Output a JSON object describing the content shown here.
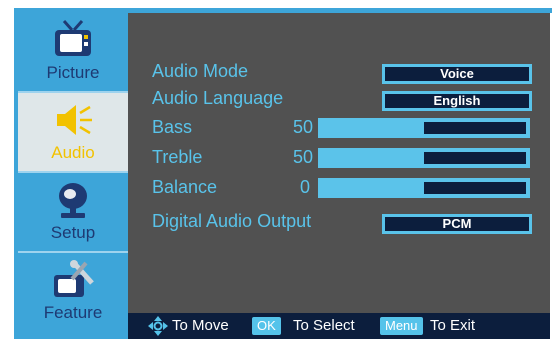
{
  "sidebar": {
    "items": [
      {
        "label": "Picture",
        "icon": "tv-icon"
      },
      {
        "label": "Audio",
        "icon": "speaker-icon",
        "active": true
      },
      {
        "label": "Setup",
        "icon": "satellite-dish-icon"
      },
      {
        "label": "Feature",
        "icon": "tv-tools-icon"
      }
    ]
  },
  "menu": {
    "audio_mode": {
      "label": "Audio Mode",
      "value": "Voice"
    },
    "audio_language": {
      "label": "Audio Language",
      "value": "English"
    },
    "bass": {
      "label": "Bass",
      "value": "50",
      "level": 0.5
    },
    "treble": {
      "label": "Treble",
      "value": "50",
      "level": 0.5
    },
    "balance": {
      "label": "Balance",
      "value": "0",
      "level": 0.5
    },
    "digital_audio_output": {
      "label": "Digital Audio Output",
      "value": "PCM"
    }
  },
  "footer": {
    "move": "To Move",
    "ok_key": "OK",
    "select": "To Select",
    "menu_key": "Menu",
    "exit": "To Exit"
  },
  "colors": {
    "sidebar_bg": "#3da5d9",
    "active_bg": "#dfe7e9",
    "active_label": "#f2c200",
    "main_bg": "#515151",
    "text": "#59c3ea",
    "dark": "#0c1e3d"
  }
}
